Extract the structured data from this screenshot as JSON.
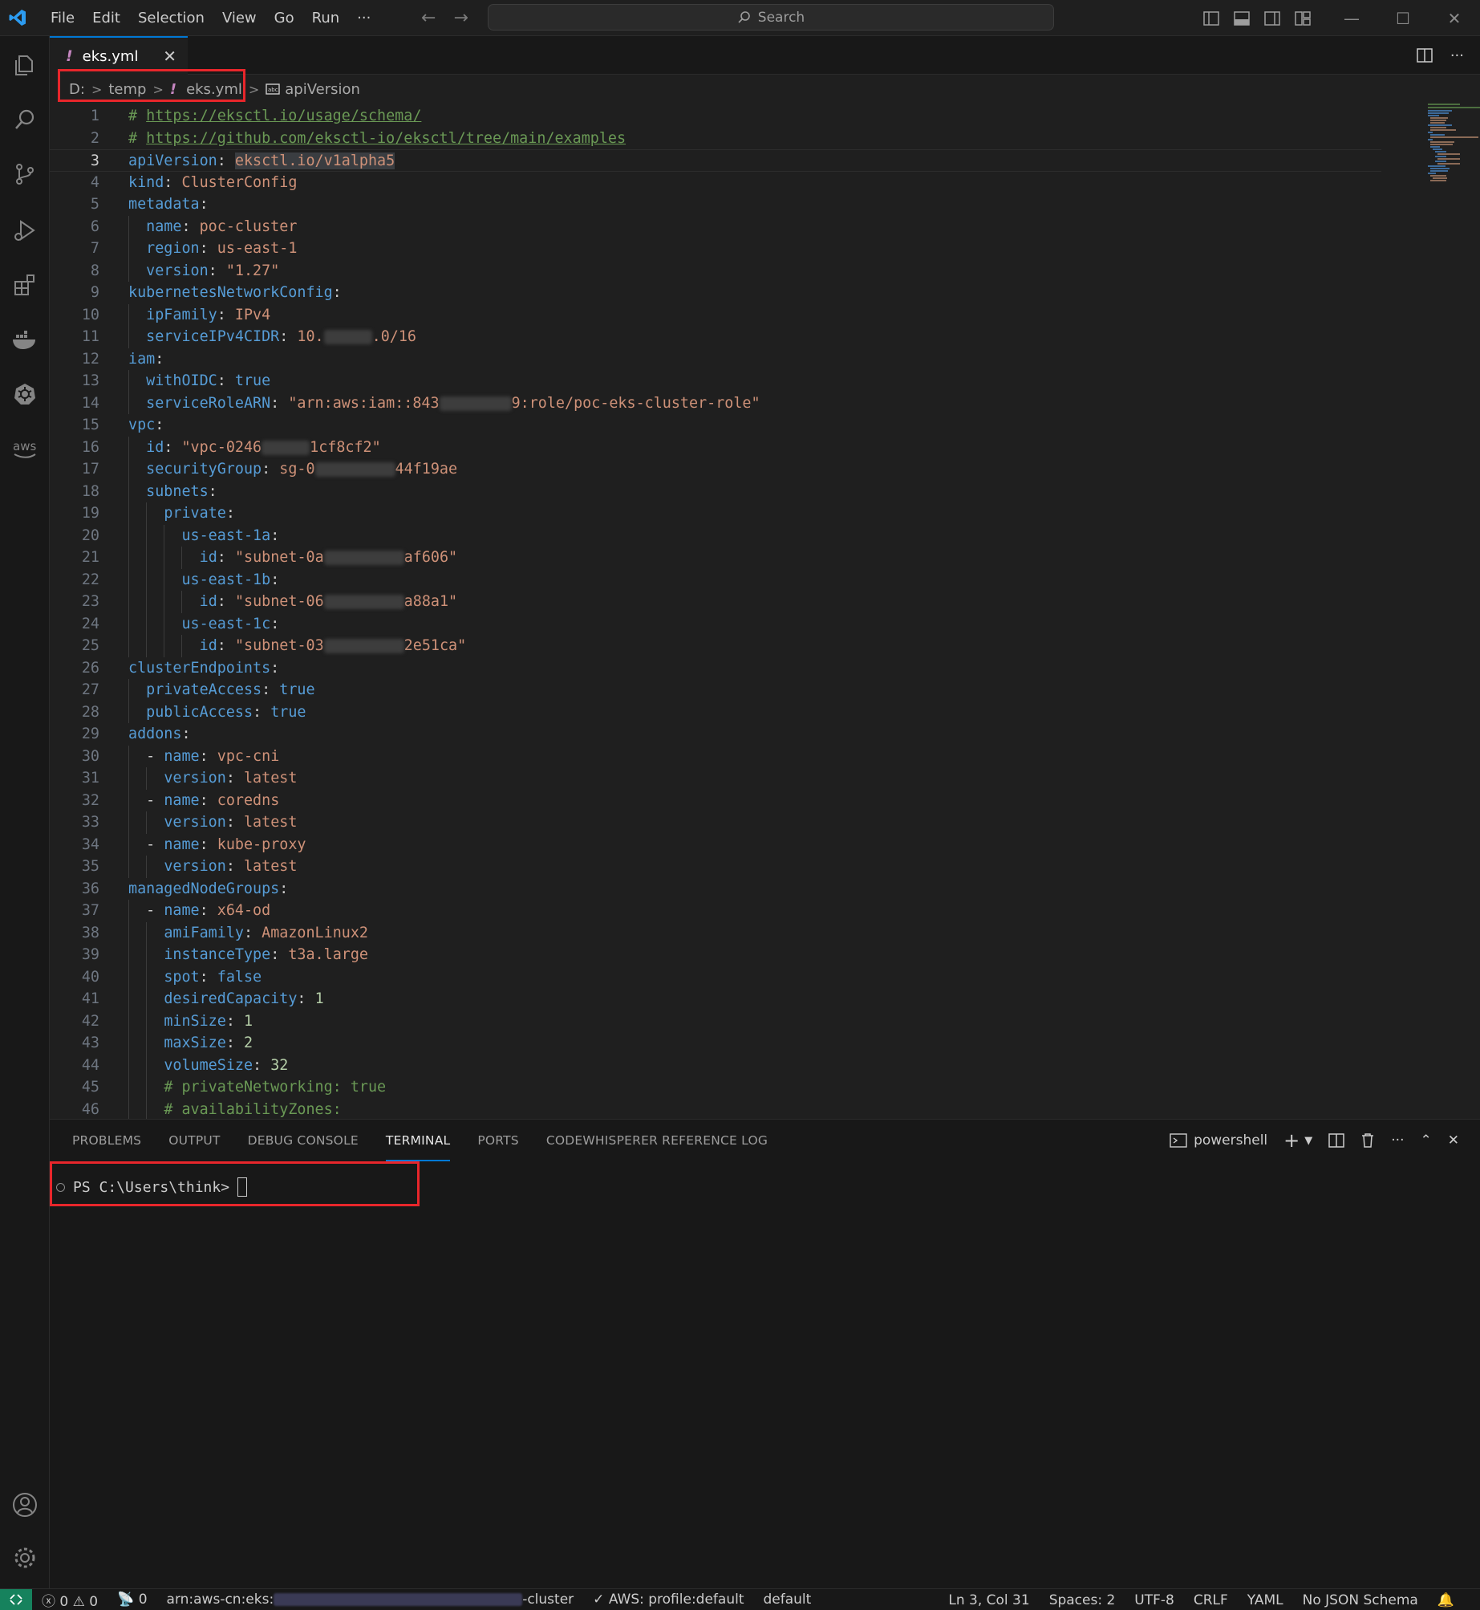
{
  "menu": [
    "File",
    "Edit",
    "Selection",
    "View",
    "Go",
    "Run",
    "···"
  ],
  "search": {
    "label": "Search"
  },
  "tab": {
    "label": "eks.yml",
    "close": "✕",
    "bang": "!"
  },
  "breadcrumb": {
    "drive": "D:",
    "folder": "temp",
    "file": "eks.yml",
    "symbol": "apiVersion"
  },
  "editor": {
    "current_line": 3,
    "lines": [
      {
        "n": 1,
        "indent": 0,
        "t": [
          [
            "c",
            "# "
          ],
          [
            "u",
            "https://eksctl.io/usage/schema/"
          ]
        ]
      },
      {
        "n": 2,
        "indent": 0,
        "t": [
          [
            "c",
            "# "
          ],
          [
            "u",
            "https://github.com/eksctl-io/eksctl/tree/main/examples"
          ]
        ]
      },
      {
        "n": 3,
        "indent": 0,
        "t": [
          [
            "k",
            "apiVersion"
          ],
          [
            "p",
            ": "
          ],
          [
            "s",
            "eksctl.io/v1alpha5"
          ]
        ]
      },
      {
        "n": 4,
        "indent": 0,
        "t": [
          [
            "k",
            "kind"
          ],
          [
            "p",
            ": "
          ],
          [
            "s",
            "ClusterConfig"
          ]
        ]
      },
      {
        "n": 5,
        "indent": 0,
        "t": [
          [
            "k",
            "metadata"
          ],
          [
            "p",
            ":"
          ]
        ]
      },
      {
        "n": 6,
        "indent": 1,
        "t": [
          [
            "k",
            "name"
          ],
          [
            "p",
            ": "
          ],
          [
            "s",
            "poc-cluster"
          ]
        ]
      },
      {
        "n": 7,
        "indent": 1,
        "t": [
          [
            "k",
            "region"
          ],
          [
            "p",
            ": "
          ],
          [
            "s",
            "us-east-1"
          ]
        ]
      },
      {
        "n": 8,
        "indent": 1,
        "t": [
          [
            "k",
            "version"
          ],
          [
            "p",
            ": "
          ],
          [
            "s",
            "\"1.27\""
          ]
        ]
      },
      {
        "n": 9,
        "indent": 0,
        "t": [
          [
            "k",
            "kubernetesNetworkConfig"
          ],
          [
            "p",
            ":"
          ]
        ]
      },
      {
        "n": 10,
        "indent": 1,
        "t": [
          [
            "k",
            "ipFamily"
          ],
          [
            "p",
            ": "
          ],
          [
            "s",
            "IPv4"
          ]
        ]
      },
      {
        "n": 11,
        "indent": 1,
        "t": [
          [
            "k",
            "serviceIPv4CIDR"
          ],
          [
            "p",
            ": "
          ],
          [
            "s",
            "10."
          ],
          [
            "r",
            "60"
          ],
          [
            "s",
            ".0/16"
          ]
        ]
      },
      {
        "n": 12,
        "indent": 0,
        "t": [
          [
            "k",
            "iam"
          ],
          [
            "p",
            ":"
          ]
        ]
      },
      {
        "n": 13,
        "indent": 1,
        "t": [
          [
            "k",
            "withOIDC"
          ],
          [
            "p",
            ": "
          ],
          [
            "k",
            "true"
          ]
        ]
      },
      {
        "n": 14,
        "indent": 1,
        "t": [
          [
            "k",
            "serviceRoleARN"
          ],
          [
            "p",
            ": "
          ],
          [
            "s",
            "\"arn:aws:iam::843"
          ],
          [
            "r",
            "90"
          ],
          [
            "s",
            "9:role/poc-eks-cluster-role\""
          ]
        ]
      },
      {
        "n": 15,
        "indent": 0,
        "t": [
          [
            "k",
            "vpc"
          ],
          [
            "p",
            ":"
          ]
        ]
      },
      {
        "n": 16,
        "indent": 1,
        "t": [
          [
            "k",
            "id"
          ],
          [
            "p",
            ": "
          ],
          [
            "s",
            "\"vpc-0246"
          ],
          [
            "r",
            "60"
          ],
          [
            "s",
            "1cf8cf2\""
          ]
        ]
      },
      {
        "n": 17,
        "indent": 1,
        "t": [
          [
            "k",
            "securityGroup"
          ],
          [
            "p",
            ": "
          ],
          [
            "s",
            "sg-0"
          ],
          [
            "r",
            "100"
          ],
          [
            "s",
            "44f19ae"
          ]
        ]
      },
      {
        "n": 18,
        "indent": 1,
        "t": [
          [
            "k",
            "subnets"
          ],
          [
            "p",
            ":"
          ]
        ]
      },
      {
        "n": 19,
        "indent": 2,
        "t": [
          [
            "k",
            "private"
          ],
          [
            "p",
            ":"
          ]
        ]
      },
      {
        "n": 20,
        "indent": 3,
        "t": [
          [
            "k",
            "us-east-1a"
          ],
          [
            "p",
            ":"
          ]
        ]
      },
      {
        "n": 21,
        "indent": 4,
        "t": [
          [
            "k",
            "id"
          ],
          [
            "p",
            ": "
          ],
          [
            "s",
            "\"subnet-0a"
          ],
          [
            "r",
            "100"
          ],
          [
            "s",
            "af606\""
          ]
        ]
      },
      {
        "n": 22,
        "indent": 3,
        "t": [
          [
            "k",
            "us-east-1b"
          ],
          [
            "p",
            ":"
          ]
        ]
      },
      {
        "n": 23,
        "indent": 4,
        "t": [
          [
            "k",
            "id"
          ],
          [
            "p",
            ": "
          ],
          [
            "s",
            "\"subnet-06"
          ],
          [
            "r",
            "100"
          ],
          [
            "s",
            "a88a1\""
          ]
        ]
      },
      {
        "n": 24,
        "indent": 3,
        "t": [
          [
            "k",
            "us-east-1c"
          ],
          [
            "p",
            ":"
          ]
        ]
      },
      {
        "n": 25,
        "indent": 4,
        "t": [
          [
            "k",
            "id"
          ],
          [
            "p",
            ": "
          ],
          [
            "s",
            "\"subnet-03"
          ],
          [
            "r",
            "100"
          ],
          [
            "s",
            "2e51ca\""
          ]
        ]
      },
      {
        "n": 26,
        "indent": 0,
        "t": [
          [
            "k",
            "clusterEndpoints"
          ],
          [
            "p",
            ":"
          ]
        ]
      },
      {
        "n": 27,
        "indent": 1,
        "t": [
          [
            "k",
            "privateAccess"
          ],
          [
            "p",
            ": "
          ],
          [
            "k",
            "true"
          ]
        ]
      },
      {
        "n": 28,
        "indent": 1,
        "t": [
          [
            "k",
            "publicAccess"
          ],
          [
            "p",
            ": "
          ],
          [
            "k",
            "true"
          ]
        ]
      },
      {
        "n": 29,
        "indent": 0,
        "t": [
          [
            "k",
            "addons"
          ],
          [
            "p",
            ":"
          ]
        ]
      },
      {
        "n": 30,
        "indent": 1,
        "t": [
          [
            "p",
            "- "
          ],
          [
            "k",
            "name"
          ],
          [
            "p",
            ": "
          ],
          [
            "s",
            "vpc-cni"
          ]
        ]
      },
      {
        "n": 31,
        "indent": 2,
        "t": [
          [
            "k",
            "version"
          ],
          [
            "p",
            ": "
          ],
          [
            "s",
            "latest"
          ]
        ]
      },
      {
        "n": 32,
        "indent": 1,
        "t": [
          [
            "p",
            "- "
          ],
          [
            "k",
            "name"
          ],
          [
            "p",
            ": "
          ],
          [
            "s",
            "coredns"
          ]
        ]
      },
      {
        "n": 33,
        "indent": 2,
        "t": [
          [
            "k",
            "version"
          ],
          [
            "p",
            ": "
          ],
          [
            "s",
            "latest"
          ]
        ]
      },
      {
        "n": 34,
        "indent": 1,
        "t": [
          [
            "p",
            "- "
          ],
          [
            "k",
            "name"
          ],
          [
            "p",
            ": "
          ],
          [
            "s",
            "kube-proxy"
          ]
        ]
      },
      {
        "n": 35,
        "indent": 2,
        "t": [
          [
            "k",
            "version"
          ],
          [
            "p",
            ": "
          ],
          [
            "s",
            "latest"
          ]
        ]
      },
      {
        "n": 36,
        "indent": 0,
        "t": [
          [
            "k",
            "managedNodeGroups"
          ],
          [
            "p",
            ":"
          ]
        ]
      },
      {
        "n": 37,
        "indent": 1,
        "t": [
          [
            "p",
            "- "
          ],
          [
            "k",
            "name"
          ],
          [
            "p",
            ": "
          ],
          [
            "s",
            "x64-od"
          ]
        ]
      },
      {
        "n": 38,
        "indent": 2,
        "t": [
          [
            "k",
            "amiFamily"
          ],
          [
            "p",
            ": "
          ],
          [
            "s",
            "AmazonLinux2"
          ]
        ]
      },
      {
        "n": 39,
        "indent": 2,
        "t": [
          [
            "k",
            "instanceType"
          ],
          [
            "p",
            ": "
          ],
          [
            "s",
            "t3a.large"
          ]
        ]
      },
      {
        "n": 40,
        "indent": 2,
        "t": [
          [
            "k",
            "spot"
          ],
          [
            "p",
            ": "
          ],
          [
            "k",
            "false"
          ]
        ]
      },
      {
        "n": 41,
        "indent": 2,
        "t": [
          [
            "k",
            "desiredCapacity"
          ],
          [
            "p",
            ": "
          ],
          [
            "n",
            "1"
          ]
        ]
      },
      {
        "n": 42,
        "indent": 2,
        "t": [
          [
            "k",
            "minSize"
          ],
          [
            "p",
            ": "
          ],
          [
            "n",
            "1"
          ]
        ]
      },
      {
        "n": 43,
        "indent": 2,
        "t": [
          [
            "k",
            "maxSize"
          ],
          [
            "p",
            ": "
          ],
          [
            "n",
            "2"
          ]
        ]
      },
      {
        "n": 44,
        "indent": 2,
        "t": [
          [
            "k",
            "volumeSize"
          ],
          [
            "p",
            ": "
          ],
          [
            "n",
            "32"
          ]
        ]
      },
      {
        "n": 45,
        "indent": 2,
        "t": [
          [
            "c",
            "# privateNetworking: true"
          ]
        ]
      },
      {
        "n": 46,
        "indent": 2,
        "t": [
          [
            "c",
            "# availabilityZones:"
          ]
        ]
      }
    ]
  },
  "panel": {
    "tabs": [
      "PROBLEMS",
      "OUTPUT",
      "DEBUG CONSOLE",
      "TERMINAL",
      "PORTS",
      "CODEWHISPERER REFERENCE LOG"
    ],
    "active_tab": "TERMINAL",
    "shell": "powershell",
    "prompt": "PS C:\\Users\\think>"
  },
  "status": {
    "errors": "0",
    "warnings": "0",
    "ports": "0",
    "arn_prefix": "arn:aws-cn:eks:",
    "arn_suffix": "-cluster",
    "aws_profile": "AWS: profile:default",
    "profile": "default",
    "position": "Ln 3, Col 31",
    "spaces": "Spaces: 2",
    "encoding": "UTF-8",
    "eol": "CRLF",
    "language": "YAML",
    "schema": "No JSON Schema"
  },
  "colors": {
    "accent": "#0078d4",
    "highlight_box": "#e8262b",
    "remote": "#16825d"
  }
}
